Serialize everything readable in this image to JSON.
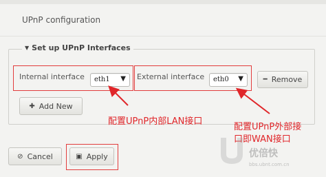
{
  "page": {
    "title": "UPnP configuration"
  },
  "section": {
    "legend": "Set up UPnP Interfaces",
    "internal_label": "Internal interface",
    "internal_value": "eth1",
    "external_label": "External interface",
    "external_value": "eth0",
    "remove_label": "Remove",
    "add_label": "Add New"
  },
  "footer": {
    "cancel_label": "Cancel",
    "apply_label": "Apply"
  },
  "annotations": {
    "internal_note": "配置UPnP内部LAN接口",
    "external_note_line1": "配置UPnP外部接",
    "external_note_line2": "口即WAN接口"
  },
  "watermark": {
    "text": "优倍快",
    "sub": "bbs.ubnt.com.cn"
  },
  "colors": {
    "highlight": "#e23b3b",
    "annotation": "#e0262a",
    "background": "#f3f3f1"
  },
  "icons": {
    "legend": "caret-down-icon",
    "select": "select-arrow-icon",
    "remove": "minus-icon",
    "add": "plus-icon",
    "cancel": "cancel-circle-icon",
    "apply": "save-icon",
    "watermark": "watermark-logo-icon"
  }
}
